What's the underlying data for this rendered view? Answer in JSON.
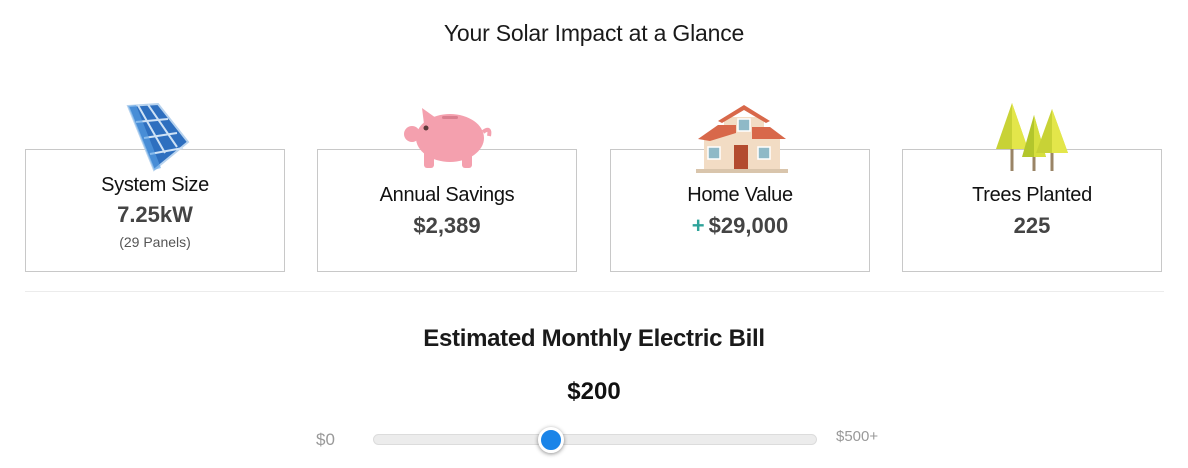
{
  "header": {
    "title": "Your Solar Impact at a Glance"
  },
  "cards": [
    {
      "icon": "solar-panel-icon",
      "label": "System Size",
      "value": "7.25kW",
      "sub": "(29 Panels)"
    },
    {
      "icon": "piggy-bank-icon",
      "label": "Annual Savings",
      "value": "$2,389"
    },
    {
      "icon": "house-icon",
      "prefix": "+",
      "label": "Home Value",
      "value": "$29,000"
    },
    {
      "icon": "trees-icon",
      "label": "Trees Planted",
      "value": "225"
    }
  ],
  "bill": {
    "title": "Estimated Monthly Electric Bill",
    "value": "$200",
    "slider": {
      "min_label": "$0",
      "max_label": "$500+",
      "fraction": 0.4
    }
  },
  "colors": {
    "accent": "#1a84e8",
    "plus": "#2fa39a",
    "piggy": "#f4a0ae"
  }
}
